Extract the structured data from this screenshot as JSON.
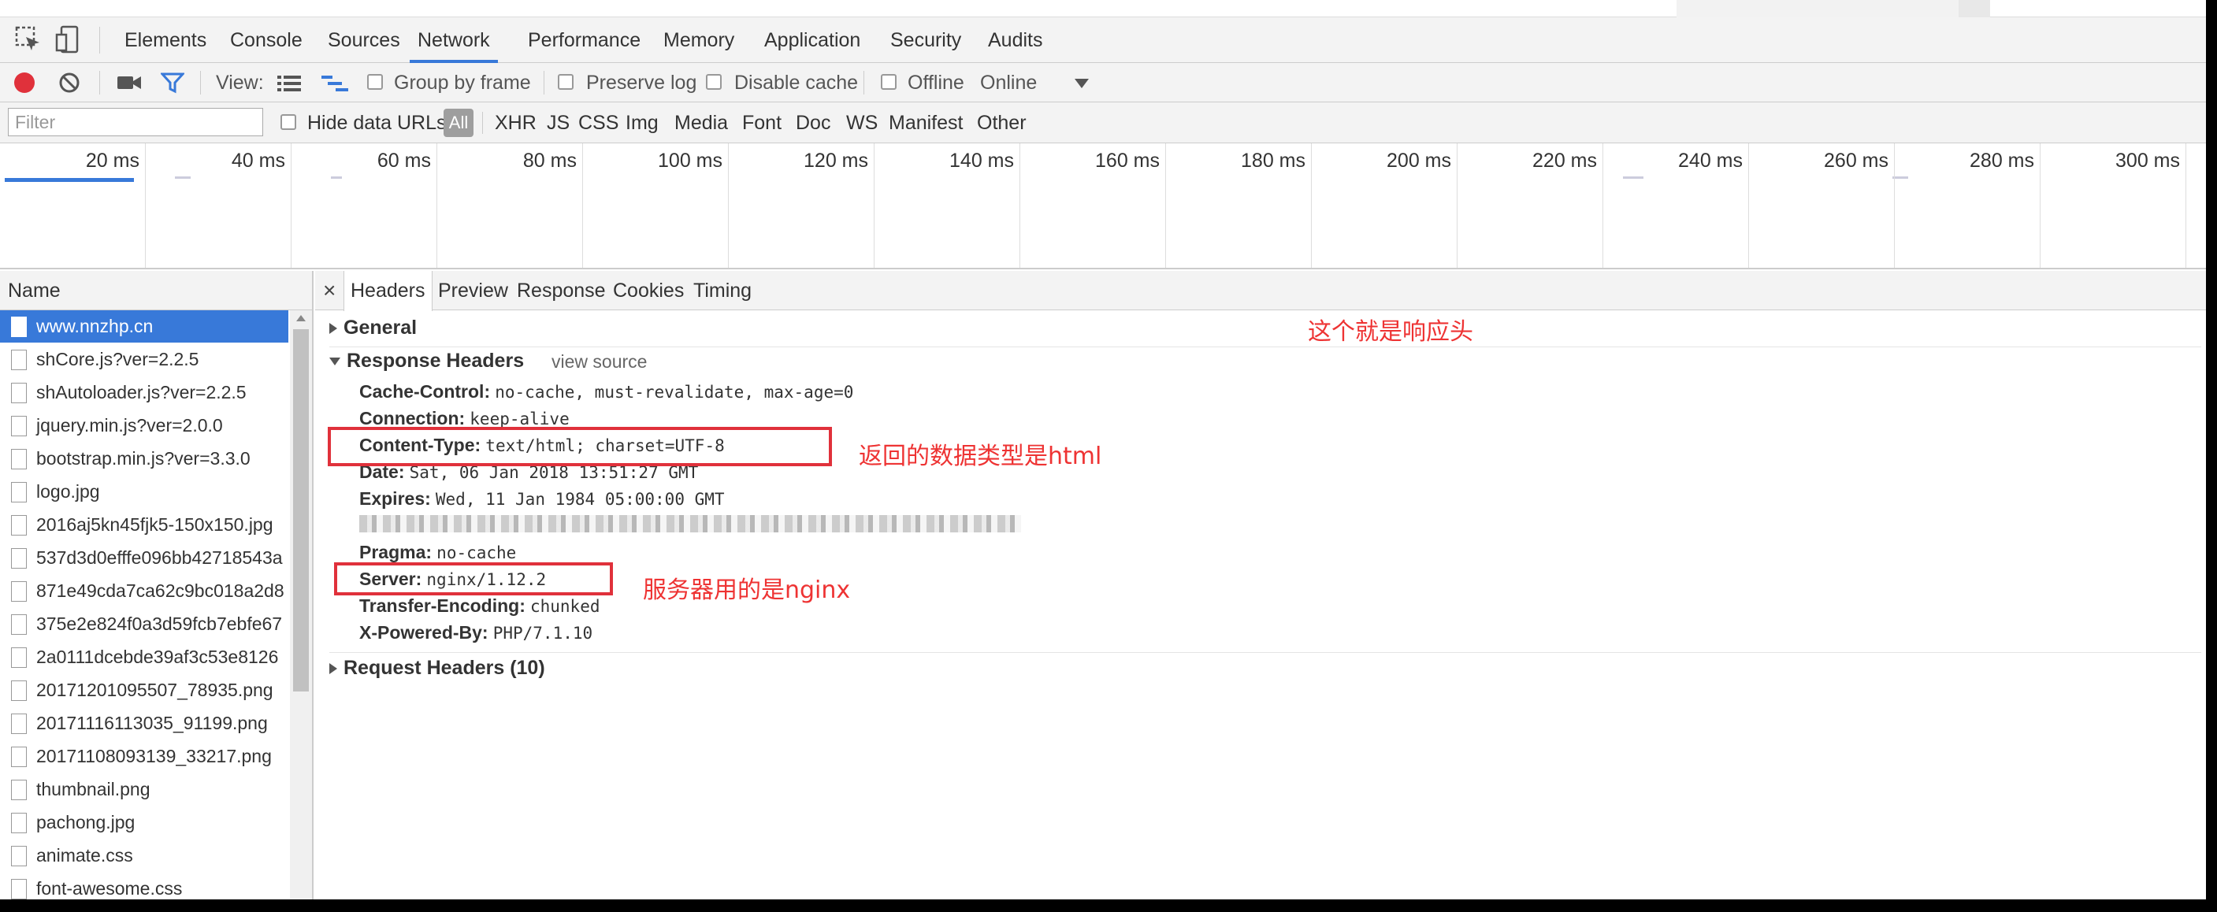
{
  "devtools": {
    "tabs": [
      "Elements",
      "Console",
      "Sources",
      "Network",
      "Performance",
      "Memory",
      "Application",
      "Security",
      "Audits"
    ],
    "active_tab": "Network"
  },
  "network_toolbar": {
    "view_label": "View:",
    "group_by_frame": "Group by frame",
    "preserve_log": "Preserve log",
    "disable_cache": "Disable cache",
    "offline": "Offline",
    "online": "Online",
    "record_color": "#e0313b"
  },
  "filter_bar": {
    "placeholder": "Filter",
    "hide_data_urls": "Hide data URLs",
    "all": "All",
    "types": [
      "XHR",
      "JS",
      "CSS",
      "Img",
      "Media",
      "Font",
      "Doc",
      "WS",
      "Manifest",
      "Other"
    ]
  },
  "timeline": {
    "ticks": [
      "20 ms",
      "40 ms",
      "60 ms",
      "80 ms",
      "100 ms",
      "120 ms",
      "140 ms",
      "160 ms",
      "180 ms",
      "200 ms",
      "220 ms",
      "240 ms",
      "260 ms",
      "280 ms",
      "300 ms"
    ]
  },
  "name_panel": {
    "header": "Name",
    "files": [
      "www.nnzhp.cn",
      "shCore.js?ver=2.2.5",
      "shAutoloader.js?ver=2.2.5",
      "jquery.min.js?ver=2.0.0",
      "bootstrap.min.js?ver=3.3.0",
      "logo.jpg",
      "2016aj5kn45fjk5-150x150.jpg",
      "537d3d0efffe096bb42718543a",
      "871e49cda7ca62c9bc018a2d8",
      "375e2e824f0a3d59fcb7ebfe67",
      "2a0111dcebde39af3c53e8126",
      "20171201095507_78935.png",
      "20171116113035_91199.png",
      "20171108093139_33217.png",
      "thumbnail.png",
      "pachong.jpg",
      "animate.css",
      "font-awesome.css"
    ]
  },
  "detail": {
    "close": "×",
    "subtabs": [
      "Headers",
      "Preview",
      "Response",
      "Cookies",
      "Timing"
    ],
    "general": "General",
    "response_headers": "Response Headers",
    "view_source": "view source",
    "headers": [
      {
        "k": "Cache-Control:",
        "v": "no-cache, must-revalidate, max-age=0"
      },
      {
        "k": "Connection:",
        "v": "keep-alive"
      },
      {
        "k": "Content-Type:",
        "v": "text/html; charset=UTF-8"
      },
      {
        "k": "Date:",
        "v": "Sat, 06 Jan 2018 13:51:27 GMT"
      },
      {
        "k": "Expires:",
        "v": "Wed, 11 Jan 1984 05:00:00 GMT"
      },
      {
        "k": "Pragma:",
        "v": "no-cache"
      },
      {
        "k": "Server:",
        "v": "nginx/1.12.2"
      },
      {
        "k": "Transfer-Encoding:",
        "v": "chunked"
      },
      {
        "k": "X-Powered-By:",
        "v": "PHP/7.1.10"
      }
    ],
    "request_headers": "Request Headers (10)"
  },
  "annotations": {
    "response_header": "这个就是响应头",
    "content_type": "返回的数据类型是html",
    "server": "服务器用的是nginx",
    "color": "#ee3333"
  }
}
